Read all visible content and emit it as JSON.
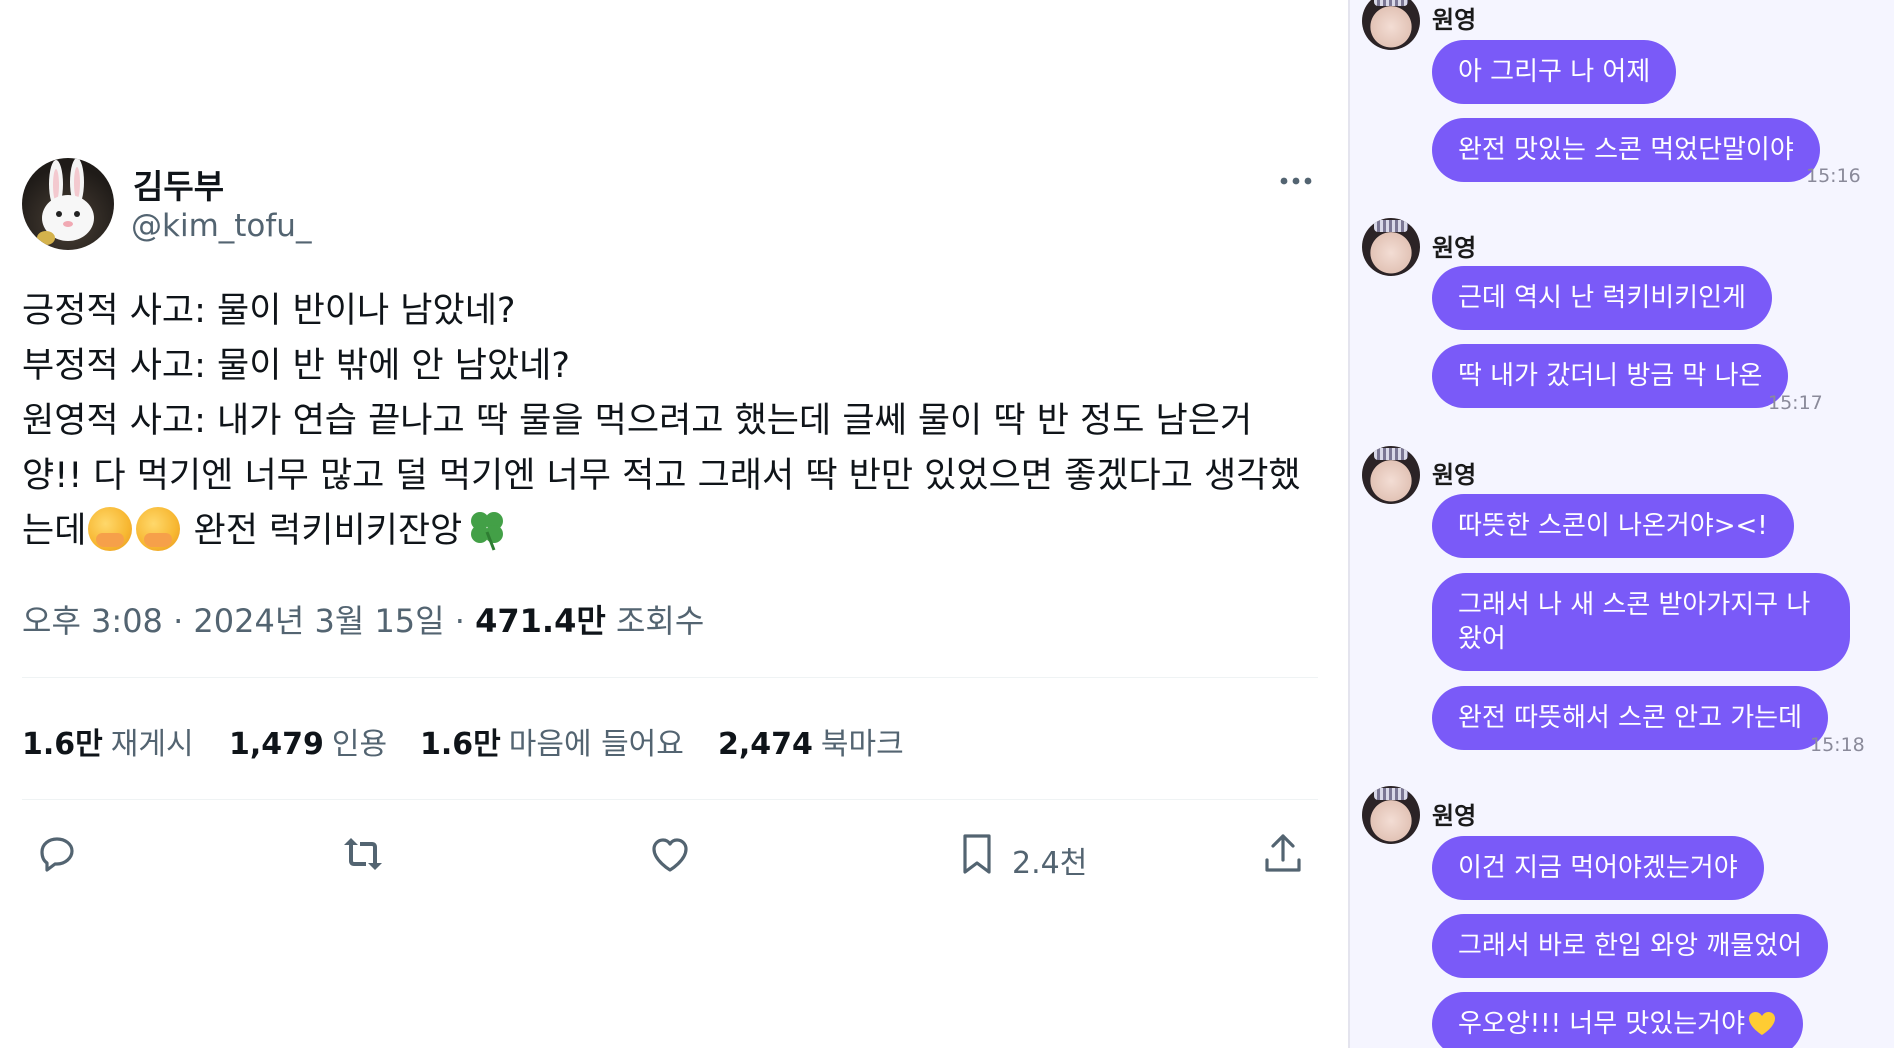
{
  "tweet": {
    "author": {
      "name": "김두부",
      "handle": "@kim_tofu_"
    },
    "body_lines": [
      "긍정적 사고: 물이 반이나 남았네?",
      "부정적 사고: 물이 반 밖에 안 남았네?",
      "원영적 사고: 내가 연습 끝나고 딱 물을 먹으려고 했는데 글쎄 물이 딱 반 정도 남은거",
      "양!! 다 먹기엔 너무 많고 덜 먹기엔 너무 적고 그래서 딱 반만 있었으면 좋겠다고 생각했"
    ],
    "last_line_prefix": "는데",
    "last_line_suffix": " 완전 럭키비키잔앙",
    "timestamp": "오후 3:08 · 2024년 3월 15일 · ",
    "views_count": "471.4만",
    "views_label": " 조회수",
    "stats": [
      {
        "count": "1.6만",
        "label": "재게시"
      },
      {
        "count": "1,479",
        "label": "인용"
      },
      {
        "count": "1.6만",
        "label": "마음에 들어요"
      },
      {
        "count": "2,474",
        "label": "북마크"
      }
    ],
    "bookmark_action_count": "2.4천",
    "icons": [
      "more-icon",
      "reply-icon",
      "retweet-icon",
      "like-icon",
      "bookmark-icon",
      "share-icon"
    ]
  },
  "chat": {
    "groups": [
      {
        "sender": "원영",
        "messages": [
          "아 그리구 나 어제",
          "완전 맛있는 스콘 먹었단말이야"
        ],
        "time": "15:16"
      },
      {
        "sender": "원영",
        "messages": [
          "근데 역시 난 럭키비키인게",
          "딱 내가 갔더니 방금 막 나온"
        ],
        "time": "15:17"
      },
      {
        "sender": "원영",
        "messages": [
          "따뜻한 스콘이 나온거야><!",
          "그래서 나 새 스콘 받아가지구 나왔어",
          "완전 따뜻해서 스콘 안고 가는데"
        ],
        "time": "15:18"
      },
      {
        "sender": "원영",
        "messages": [
          "이건 지금 먹어야겠는거야",
          "그래서 바로 한입 와앙 깨물었어",
          "우오앙!!! 너무 맛있는거야"
        ],
        "time": ""
      }
    ],
    "bubble_color": "#7a5af8"
  }
}
